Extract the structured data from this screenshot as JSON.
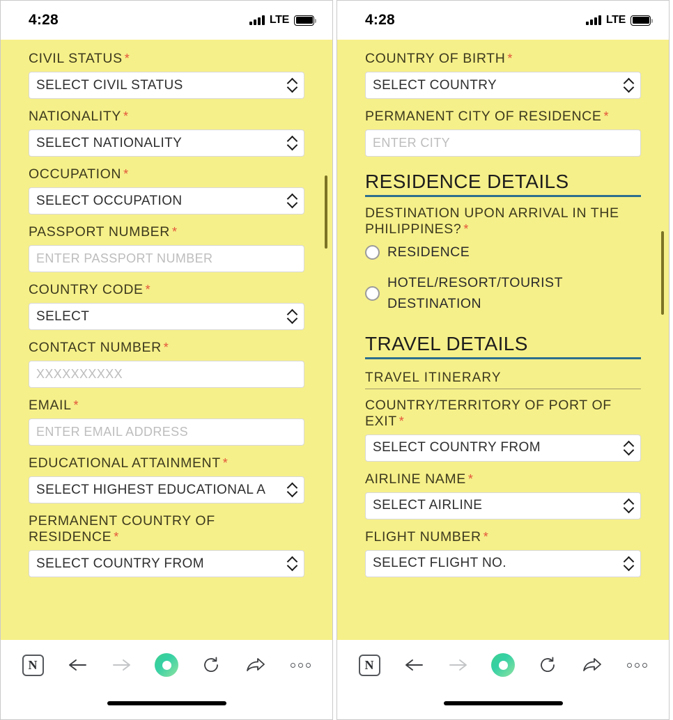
{
  "status_bar": {
    "time": "4:28",
    "network": "LTE",
    "signal_icon": "signal-bars-icon",
    "battery_icon": "battery-full-icon"
  },
  "colors": {
    "page_background": "#f6f08a",
    "section_rule": "#2d6f8e",
    "subsection_rule": "#a09a6b",
    "required_asterisk": "#e2543a",
    "scrollbar": "#7d7326",
    "field_background": "#ffffff",
    "placeholder_text": "#bdbdbd"
  },
  "left_screen": {
    "fields": [
      {
        "label": "CIVIL STATUS",
        "required": "*",
        "type": "select",
        "value": "SELECT CIVIL STATUS"
      },
      {
        "label": "NATIONALITY",
        "required": "*",
        "type": "select",
        "value": "SELECT NATIONALITY"
      },
      {
        "label": "OCCUPATION",
        "required": "*",
        "type": "select",
        "value": "SELECT OCCUPATION"
      },
      {
        "label": "PASSPORT NUMBER",
        "required": "*",
        "type": "text",
        "placeholder": "ENTER PASSPORT NUMBER"
      },
      {
        "label": "COUNTRY CODE",
        "required": "*",
        "type": "select",
        "value": "SELECT"
      },
      {
        "label": "CONTACT NUMBER",
        "required": "*",
        "type": "text",
        "placeholder": "XXXXXXXXXX"
      },
      {
        "label": "EMAIL",
        "required": "*",
        "type": "text",
        "placeholder": "ENTER EMAIL ADDRESS"
      },
      {
        "label": "EDUCATIONAL ATTAINMENT",
        "required": "*",
        "type": "select",
        "value": "SELECT HIGHEST EDUCATIONAL A"
      },
      {
        "label": "PERMANENT COUNTRY OF RESIDENCE",
        "required": "*",
        "type": "select",
        "value": "SELECT COUNTRY FROM"
      }
    ]
  },
  "right_screen": {
    "fields_top": [
      {
        "label": "COUNTRY OF BIRTH",
        "required": "*",
        "type": "select",
        "value": "SELECT COUNTRY"
      },
      {
        "label": "PERMANENT CITY OF RESIDENCE",
        "required": "*",
        "type": "text",
        "placeholder": "ENTER CITY"
      }
    ],
    "residence_section": {
      "heading": "RESIDENCE DETAILS",
      "question": "DESTINATION UPON ARRIVAL IN THE PHILIPPINES?",
      "question_required": "*",
      "options": [
        {
          "label": "RESIDENCE",
          "selected": false
        },
        {
          "label": "HOTEL/RESORT/TOURIST DESTINATION",
          "selected": false
        }
      ]
    },
    "travel_section": {
      "heading": "TRAVEL DETAILS",
      "subheading": "TRAVEL ITINERARY",
      "fields": [
        {
          "label": "COUNTRY/TERRITORY OF PORT OF EXIT",
          "required": "*",
          "type": "select",
          "value": "SELECT COUNTRY FROM"
        },
        {
          "label": "AIRLINE NAME",
          "required": "*",
          "type": "select",
          "value": "SELECT AIRLINE"
        },
        {
          "label": "FLIGHT NUMBER",
          "required": "*",
          "type": "select",
          "value": "SELECT FLIGHT NO."
        }
      ]
    }
  },
  "toolbar": {
    "app_badge": "N",
    "items": [
      {
        "name": "app-badge",
        "icon": "notion-n-icon"
      },
      {
        "name": "back",
        "icon": "arrow-left-icon",
        "enabled": true
      },
      {
        "name": "forward",
        "icon": "arrow-right-icon",
        "enabled": false
      },
      {
        "name": "record",
        "icon": "green-donut-icon"
      },
      {
        "name": "reload",
        "icon": "refresh-icon"
      },
      {
        "name": "share",
        "icon": "share-arrow-icon"
      },
      {
        "name": "more",
        "icon": "ellipsis-icon"
      }
    ]
  }
}
